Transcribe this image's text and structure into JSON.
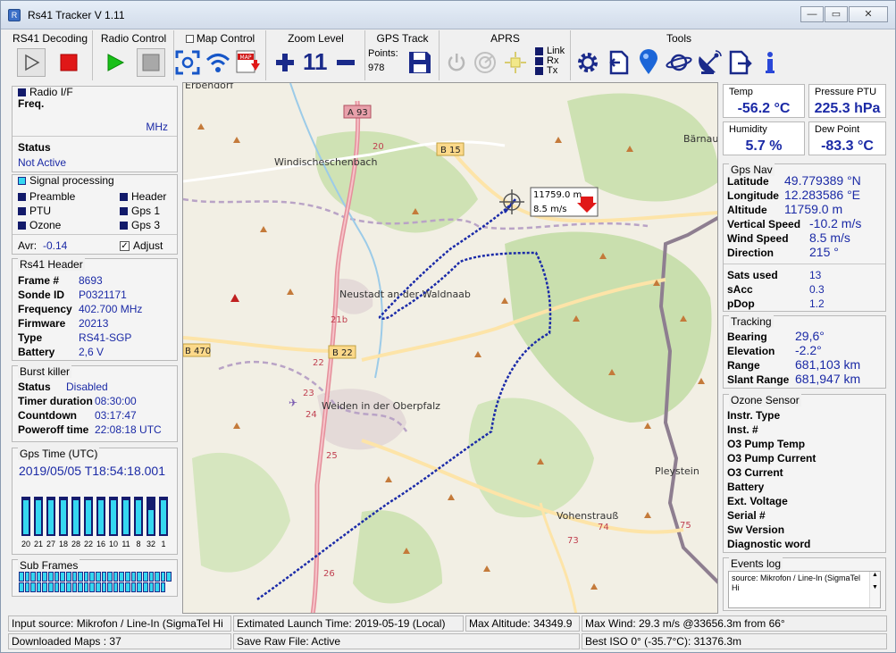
{
  "window": {
    "title": "Rs41 Tracker V 1.11"
  },
  "toolbar": {
    "rs41_decoding": "RS41 Decoding",
    "radio_control": "Radio Control",
    "map_control": "Map Control",
    "zoom_level": "Zoom Level",
    "zoom_value": "11",
    "gps_track": "GPS Track",
    "points_label": "Points:",
    "points_value": "978",
    "aprs": "APRS",
    "link": "Link",
    "rx": "Rx",
    "tx": "Tx",
    "tools": "Tools",
    "map_icon_text": "MAP"
  },
  "radio_if": {
    "title": "Radio  I/F",
    "freq_label": "Freq.",
    "unit": "MHz",
    "status_label": "Status",
    "status_value": "Not Active"
  },
  "signal": {
    "title": "Signal processing",
    "items": [
      "Preamble",
      "Header",
      "PTU",
      "Gps 1",
      "Ozone",
      "Gps 3"
    ],
    "avr_label": "Avr:",
    "avr_value": "-0.14",
    "adjust_label": "Adjust"
  },
  "rs41_header": {
    "title": "Rs41 Header",
    "rows": [
      {
        "label": "Frame #",
        "value": "8693"
      },
      {
        "label": "Sonde ID",
        "value": "P0321171"
      },
      {
        "label": "Frequency",
        "value": "402.700 MHz"
      },
      {
        "label": "Firmware",
        "value": "20213"
      },
      {
        "label": "Type",
        "value": "RS41-SGP"
      },
      {
        "label": "Battery",
        "value": "2,6 V"
      }
    ]
  },
  "burst_killer": {
    "title": "Burst killer",
    "rows": [
      {
        "label": "Status",
        "value": "Disabled"
      },
      {
        "label": "Timer duration",
        "value": "08:30:00"
      },
      {
        "label": "Countdown",
        "value": "03:17:47"
      },
      {
        "label": "Poweroff time",
        "value": "22:08:18 UTC"
      }
    ]
  },
  "gps_time": {
    "title": "Gps Time (UTC)",
    "value": "2019/05/05 T18:54:18.001",
    "bars": [
      {
        "label": "20",
        "fill": 1.0
      },
      {
        "label": "21",
        "fill": 1.0
      },
      {
        "label": "27",
        "fill": 1.0
      },
      {
        "label": "18",
        "fill": 1.0
      },
      {
        "label": "28",
        "fill": 1.0
      },
      {
        "label": "22",
        "fill": 1.0
      },
      {
        "label": "16",
        "fill": 1.0
      },
      {
        "label": "10",
        "fill": 1.0
      },
      {
        "label": "11",
        "fill": 1.0
      },
      {
        "label": "8",
        "fill": 1.0
      },
      {
        "label": "32",
        "fill": 0.7
      },
      {
        "label": "1",
        "fill": 1.0
      }
    ]
  },
  "sub_frames": {
    "title": "Sub Frames",
    "count": 51
  },
  "map": {
    "balloon_altitude": "11759.0 m",
    "balloon_speed": "8.5 m/s",
    "places": [
      "Erbendorf",
      "Windischeschenbach",
      "Neustadt an der Waldnaab",
      "Weiden in der Oberpfalz",
      "Vohenstrauß",
      "Pleystein",
      "Bärnau"
    ],
    "roads": [
      "A 93",
      "B 15",
      "B 22",
      "B 470",
      "20",
      "21b",
      "22",
      "23",
      "24",
      "25",
      "26",
      "73",
      "74",
      "75"
    ]
  },
  "measurements": [
    {
      "title": "Temp",
      "value": "-56.2 °C"
    },
    {
      "title": "Pressure PTU",
      "value": "225.3 hPa"
    },
    {
      "title": "Humidity",
      "value": "5.7 %"
    },
    {
      "title": "Dew Point",
      "value": "-83.3 °C"
    }
  ],
  "gps_nav": {
    "title": "Gps Nav",
    "rows": [
      {
        "label": "Latitude",
        "value": "49.779389 °N"
      },
      {
        "label": "Longitude",
        "value": "12.283586 °E"
      },
      {
        "label": "Altitude",
        "value": "11759.0 m"
      },
      {
        "label": "Vertical Speed",
        "value": "-10.2 m/s"
      },
      {
        "label": "Wind Speed",
        "value": "8.5 m/s"
      },
      {
        "label": "Direction",
        "value": "215 °"
      }
    ],
    "small_rows": [
      {
        "label": "Sats used",
        "value": "13"
      },
      {
        "label": "sAcc",
        "value": "0.3"
      },
      {
        "label": "pDop",
        "value": "1.2"
      }
    ]
  },
  "tracking": {
    "title": "Tracking",
    "rows": [
      {
        "label": "Bearing",
        "value": "29,6°"
      },
      {
        "label": "Elevation",
        "value": "-2.2°"
      },
      {
        "label": "Range",
        "value": "681,103 km"
      },
      {
        "label": "Slant Range",
        "value": "681,947 km"
      }
    ]
  },
  "ozone": {
    "title": "Ozone Sensor",
    "rows": [
      "Instr. Type",
      "Inst. #",
      "O3 Pump Temp",
      "O3 Pump Current",
      "O3 Current",
      "Battery",
      "Ext. Voltage",
      "Serial #",
      "Sw Version",
      "Diagnostic word"
    ]
  },
  "events": {
    "title": "Events log",
    "text": "source: Mikrofon / Line-In (SigmaTel Hi"
  },
  "statusbar": {
    "input_source": "Input source: Mikrofon / Line-In (SigmaTel Hi",
    "launch_time": "Extimated Launch Time: 2019-05-19 (Local)",
    "max_altitude": "Max Altitude: 34349.9",
    "max_wind": "Max Wind: 29.3 m/s @33656.3m from 66°",
    "downloaded_maps": "Downloaded Maps : 37",
    "save_raw": "Save Raw File: Active",
    "best_iso": "Best ISO 0° (-35.7°C): 31376.3m"
  }
}
